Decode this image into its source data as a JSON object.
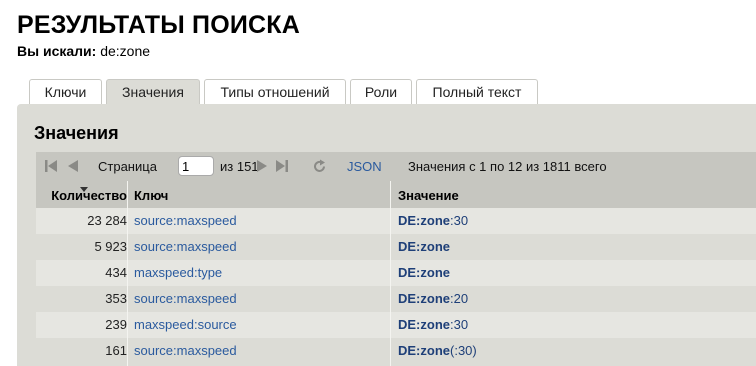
{
  "header": {
    "title": "РЕЗУЛЬТАТЫ ПОИСКА",
    "query_label": "Вы искали:",
    "query_value": "de:zone"
  },
  "tabs": [
    {
      "label": "Ключи",
      "active": false
    },
    {
      "label": "Значения",
      "active": true
    },
    {
      "label": "Типы отношений",
      "active": false
    },
    {
      "label": "Роли",
      "active": false
    },
    {
      "label": "Полный текст",
      "active": false
    }
  ],
  "panel": {
    "title": "Значения"
  },
  "pager": {
    "page_label": "Страница",
    "page_value": "1",
    "of_pages": "из 151",
    "json_link": "JSON",
    "summary": "Значения с 1 по 12 из 1811 всего",
    "icons": [
      "first-page-icon",
      "prev-page-icon",
      "next-page-icon",
      "last-page-icon",
      "reload-icon"
    ]
  },
  "columns": [
    "Количество",
    "Ключ",
    "Значение"
  ],
  "rows": [
    {
      "count": "23 284",
      "key": "source:maxspeed",
      "value_prefix": "DE:zone",
      "value_suffix": ":30"
    },
    {
      "count": "5 923",
      "key": "source:maxspeed",
      "value_prefix": "DE:zone",
      "value_suffix": ""
    },
    {
      "count": "434",
      "key": "maxspeed:type",
      "value_prefix": "DE:zone",
      "value_suffix": ""
    },
    {
      "count": "353",
      "key": "source:maxspeed",
      "value_prefix": "DE:zone",
      "value_suffix": ":20"
    },
    {
      "count": "239",
      "key": "maxspeed:source",
      "value_prefix": "DE:zone",
      "value_suffix": ":30"
    },
    {
      "count": "161",
      "key": "source:maxspeed",
      "value_prefix": "DE:zone",
      "value_suffix": "(:30)"
    }
  ],
  "colors": {
    "panel_bg": "#dcdcd6",
    "header_bg": "#c6c6c0",
    "link": "#2a5a9e",
    "value": "#1e3f78"
  }
}
